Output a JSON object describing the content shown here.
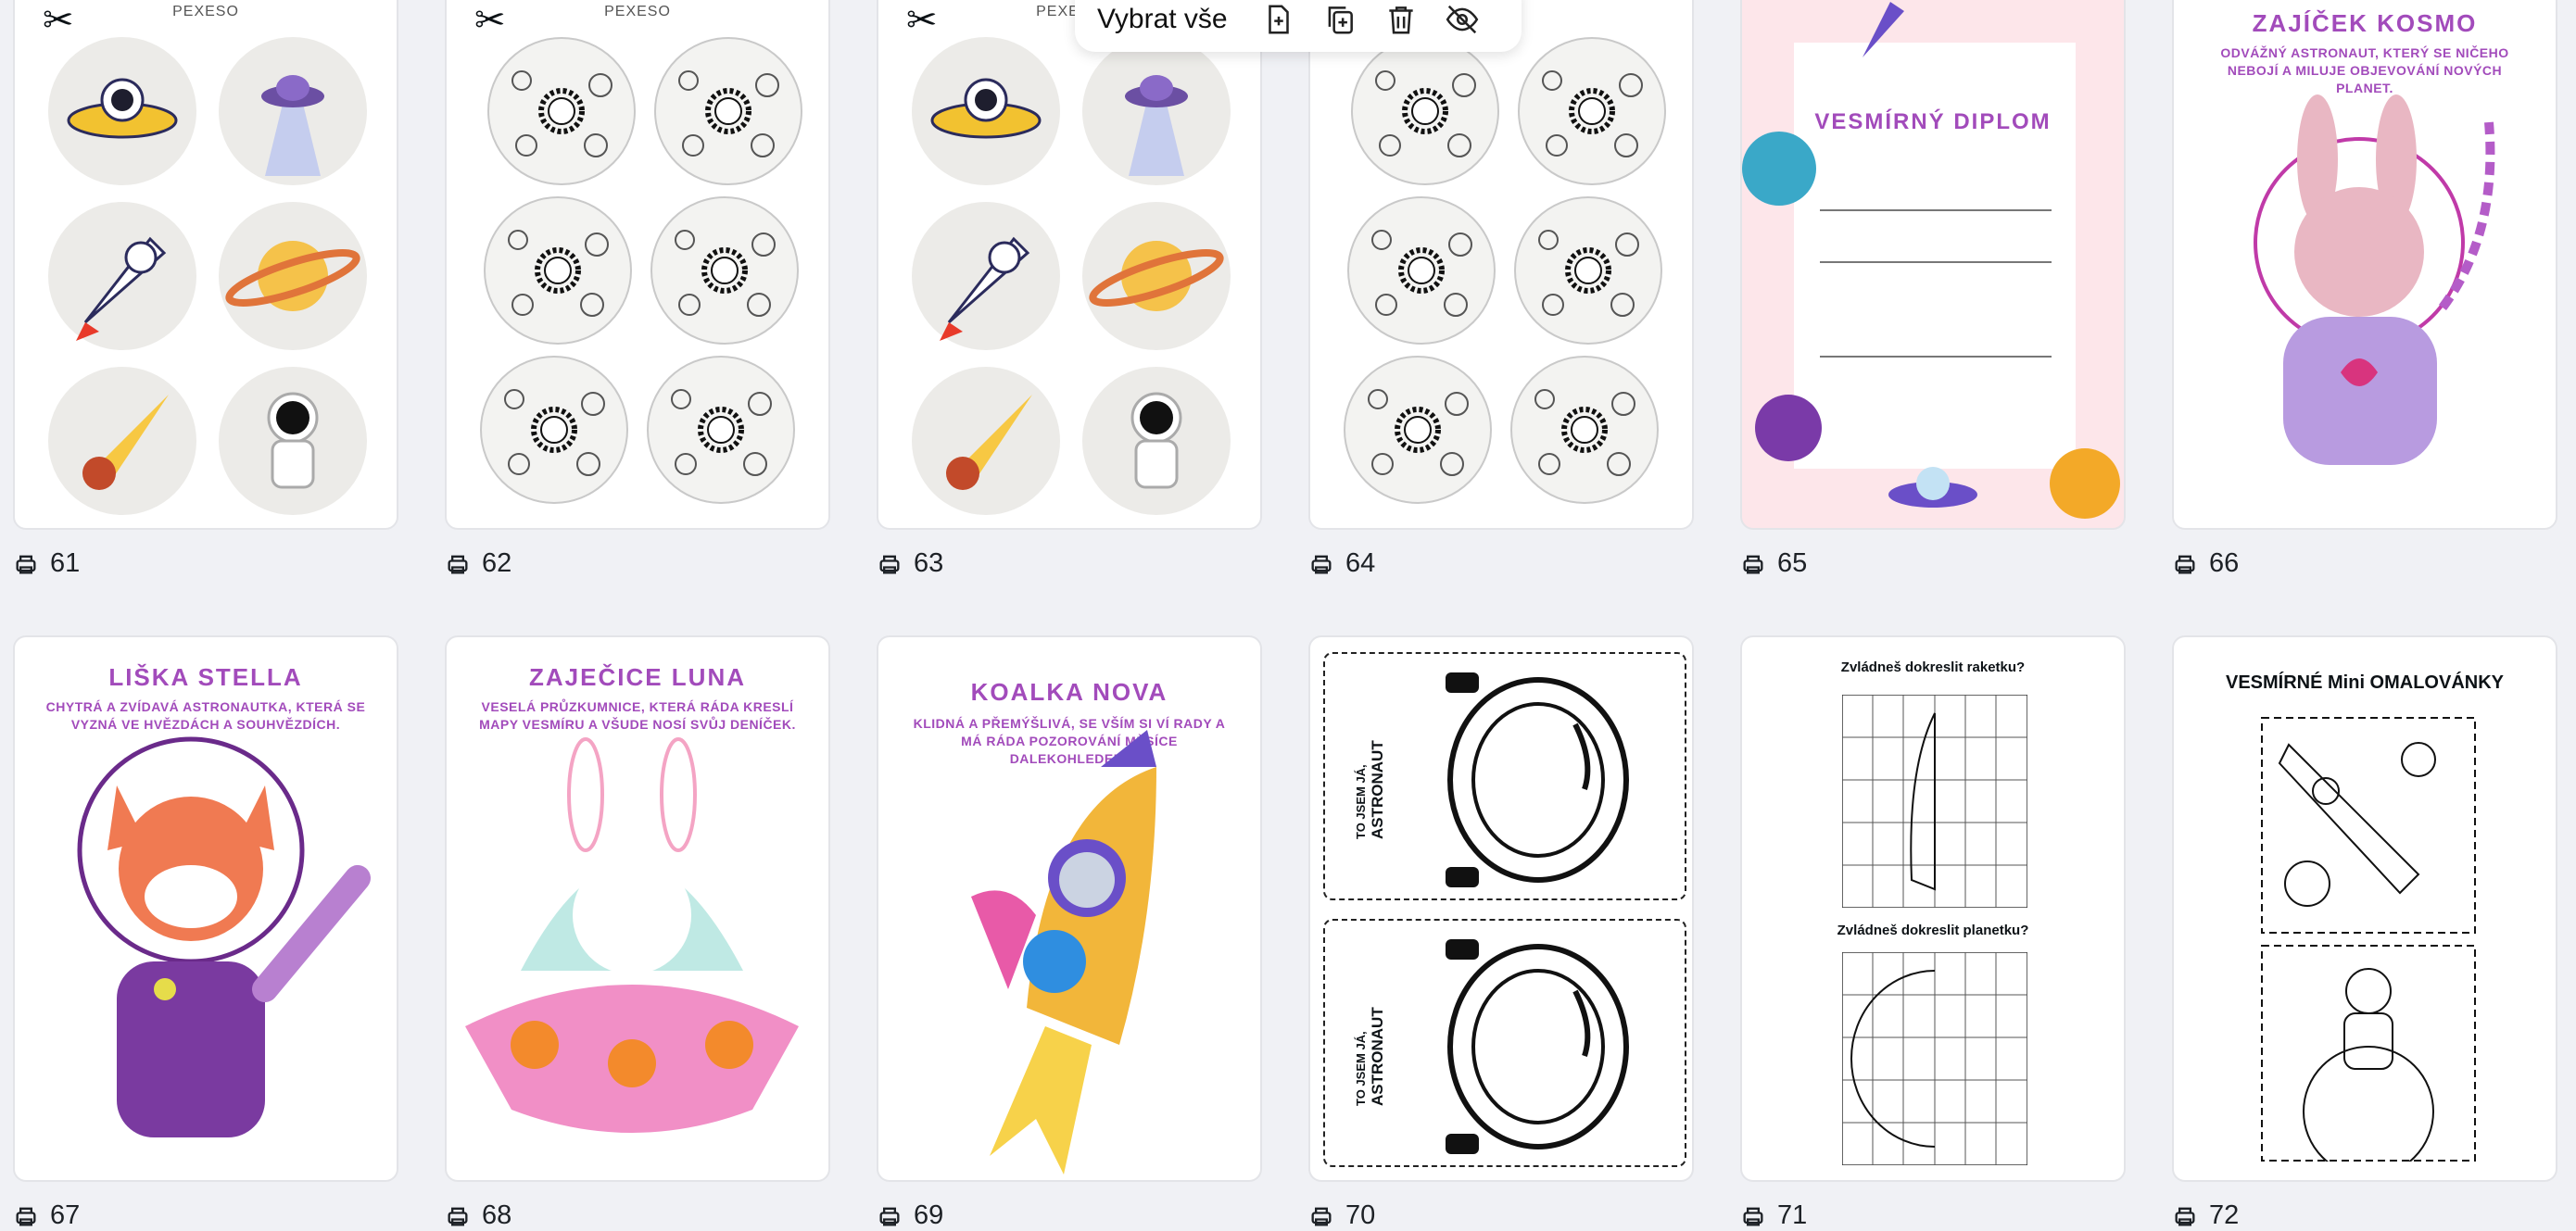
{
  "toolbar": {
    "select_all_label": "Vybrat vše"
  },
  "pages": [
    {
      "number": "61",
      "label": "PEXESO"
    },
    {
      "number": "62",
      "label": "PEXESO"
    },
    {
      "number": "63",
      "label": "PEXESO"
    },
    {
      "number": "64",
      "label": ""
    },
    {
      "number": "65",
      "title": "VESMÍRNÝ DIPLOM"
    },
    {
      "number": "66",
      "title": "ZAJÍČEK KOSMO",
      "subtitle": "ODVÁŽNÝ ASTRONAUT, KTERÝ SE NIČEHO NEBOJÍ A MILUJE OBJEVOVÁNÍ NOVÝCH PLANET."
    },
    {
      "number": "67",
      "title": "LIŠKA STELLA",
      "subtitle": "CHYTRÁ A ZVÍDAVÁ ASTRONAUTKA, KTERÁ SE VYZNÁ VE HVĚZDÁCH A SOUHVĚZDÍCH."
    },
    {
      "number": "68",
      "title": "ZAJEČICE LUNA",
      "subtitle": "VESELÁ PRŮZKUMNICE, KTERÁ RÁDA KRESLÍ MAPY VESMÍRU A VŠUDE NOSÍ SVŮJ DENÍČEK."
    },
    {
      "number": "69",
      "title": "KOALKA NOVA",
      "subtitle": "KLIDNÁ A PŘEMÝŠLIVÁ, SE VŠÍM SI VÍ RADY A MÁ RÁDA POZOROVÁNÍ MĚSÍCE DALEKOHLEDEM."
    },
    {
      "number": "70",
      "badge_text_1": "TO JSEM JÁ,",
      "badge_text_2": "ASTRONAUT"
    },
    {
      "number": "71",
      "q1": "Zvládneš dokreslit raketku?",
      "q2": "Zvládneš dokreslit planetku?"
    },
    {
      "number": "72",
      "title": "VESMÍRNÉ Mini OMALOVÁNKY"
    }
  ],
  "icons": {
    "page_type": "printer-icon",
    "toolbar": [
      "add-page-icon",
      "duplicate-icon",
      "trash-icon",
      "hide-icon"
    ]
  },
  "colors": {
    "accent_purple": "#a24bbb",
    "background": "#f0f1f5"
  }
}
